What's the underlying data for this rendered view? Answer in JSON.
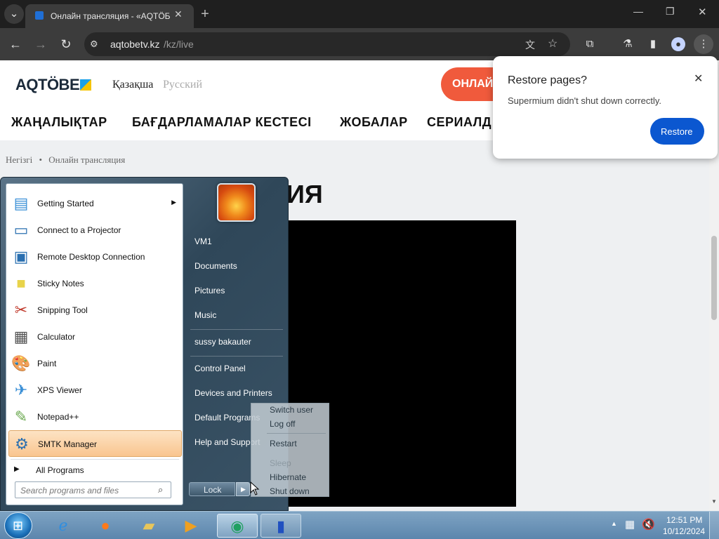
{
  "browser": {
    "tab_title": "Онлайн трансляция - «AQTÖБ",
    "url_host": "aqtobetv.kz",
    "url_path": "/kz/live"
  },
  "site": {
    "logo": "AQTÖBE",
    "lang_kz": "Қазақша",
    "lang_ru": "Русский",
    "live_button": "ОНЛАЙ",
    "nav": [
      "ЖАҢАЛЫҚТАР",
      "БАҒДАРЛАМАЛАР КЕСТЕСІ",
      "ЖОБАЛАР",
      "СЕРИАЛД"
    ],
    "breadcrumb_home": "Негізгі",
    "breadcrumb_sep": "•",
    "breadcrumb_current": "Онлайн трансляция",
    "page_title_fragment": "ИЯ"
  },
  "restore_popup": {
    "title": "Restore pages?",
    "message": "Supermium didn't shut down correctly.",
    "button": "Restore"
  },
  "start_menu": {
    "programs": [
      {
        "label": "Getting Started",
        "icon": "getting-started-icon"
      },
      {
        "label": "Connect to a Projector",
        "icon": "projector-icon"
      },
      {
        "label": "Remote Desktop Connection",
        "icon": "remote-desktop-icon"
      },
      {
        "label": "Sticky Notes",
        "icon": "sticky-notes-icon"
      },
      {
        "label": "Snipping Tool",
        "icon": "snipping-tool-icon"
      },
      {
        "label": "Calculator",
        "icon": "calculator-icon"
      },
      {
        "label": "Paint",
        "icon": "paint-icon"
      },
      {
        "label": "XPS Viewer",
        "icon": "xps-viewer-icon"
      },
      {
        "label": "Notepad++",
        "icon": "notepadpp-icon"
      },
      {
        "label": "SMTK Manager",
        "icon": "smtk-manager-icon"
      }
    ],
    "all_programs": "All Programs",
    "search_placeholder": "Search programs and files",
    "right_items": [
      "VM1",
      "Documents",
      "Pictures",
      "Music",
      "sussy bakauter",
      "Control Panel",
      "Devices and Printers",
      "Default Programs",
      "Help and Support"
    ],
    "lock_button": "Lock",
    "power_submenu": [
      "Switch user",
      "Log off",
      "Restart",
      "Sleep",
      "Hibernate",
      "Shut down"
    ]
  },
  "taskbar": {
    "time": "12:51 PM",
    "date": "10/12/2024"
  }
}
